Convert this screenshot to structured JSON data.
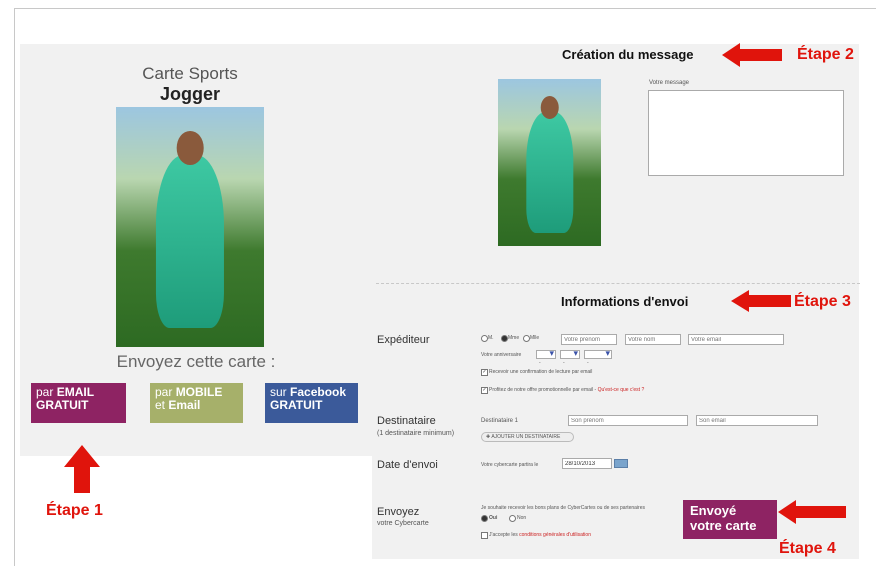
{
  "card": {
    "title": "Carte Sports",
    "name": "Jogger",
    "send_this_card": "Envoyez cette carte :"
  },
  "send_options": {
    "email": {
      "prefix": "par",
      "main": "EMAIL",
      "line2": "GRATUIT"
    },
    "mobile": {
      "prefix": "par",
      "main": "MOBILE",
      "line2_prefix": "et",
      "line2": "Email"
    },
    "facebook": {
      "prefix": "sur",
      "main": "Facebook",
      "line2": "GRATUIT"
    }
  },
  "steps": {
    "step1": "Étape 1",
    "step2": "Étape 2",
    "step3": "Étape 3",
    "step4": "Étape 4"
  },
  "message_section": {
    "heading": "Création du message",
    "message_label": "Votre message"
  },
  "sending_section": {
    "heading": "Informations d'envoi"
  },
  "sender": {
    "label": "Expéditeur",
    "title_options": [
      "M.",
      "Mme",
      "Mlle"
    ],
    "first_name_placeholder": "Votre prénom",
    "last_name_placeholder": "Votre nom",
    "email_placeholder": "Votre email",
    "birthday_label": "Votre anniversaire",
    "select_placeholder": "-",
    "confirm_text": "Recevoir une confirmation de lecture par email",
    "promo_text": "Profitez de notre offre promotionnelle par email -",
    "promo_link": "Qu'est-ce que c'est ?"
  },
  "recipient": {
    "label": "Destinataire",
    "sublabel": "(1 destinataire minimum)",
    "row_label": "Destinataire 1",
    "first_name_placeholder": "Son prénom",
    "email_placeholder": "Son email",
    "add_button": "AJOUTER UN DESTINATAIRE"
  },
  "send_date": {
    "label": "Date d'envoi",
    "text": "Votre cybercarte partira le",
    "value": "28/10/2013"
  },
  "send_card": {
    "label": "Envoyez",
    "sublabel": "votre Cybercarte",
    "offers_text": "Je souhaite recevoir les bons plans de CyberCartes ou de ses partenaires",
    "yes": "Oui",
    "no": "Non",
    "terms_prefix": "J'accepte les",
    "terms_link": "conditions générales d'utilisation",
    "button_line1": "Envoyé",
    "button_line2": "votre carte"
  },
  "colors": {
    "plum": "#8e2363",
    "olive": "#a6b06a",
    "facebook_blue": "#3b5a9a",
    "arrow_red": "#e0140c"
  }
}
